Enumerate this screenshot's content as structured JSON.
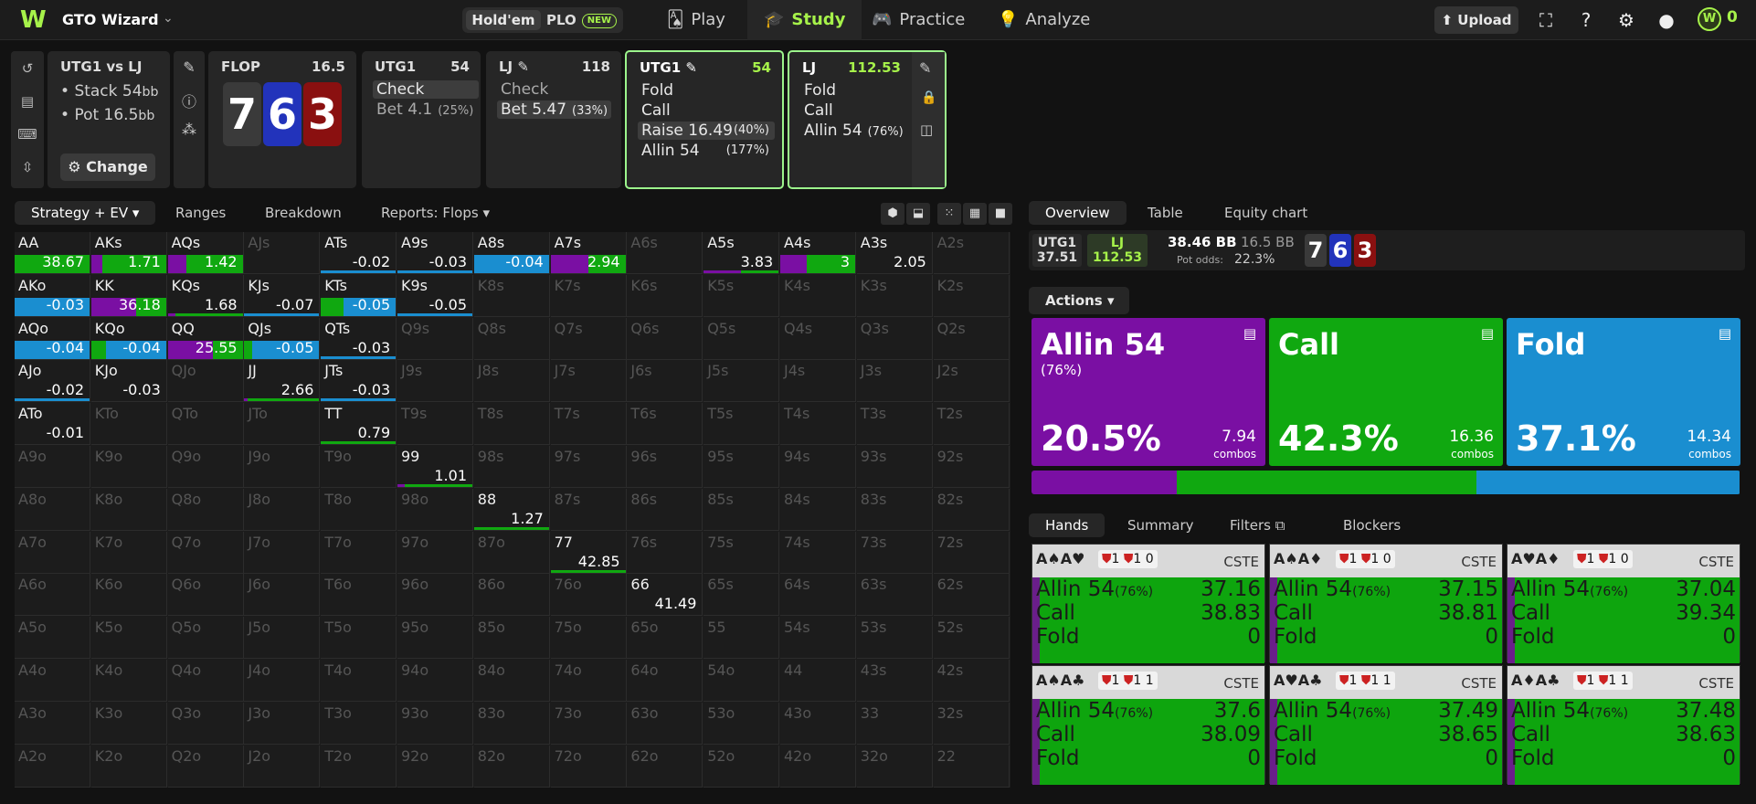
{
  "topbar": {
    "brand": "GTO Wizard",
    "game_holdem": "Hold'em",
    "game_plo": "PLO",
    "plo_badge": "NEW",
    "nav": [
      {
        "label": "Play",
        "icon": "cards-icon"
      },
      {
        "label": "Study",
        "icon": "graduation-cap-icon"
      },
      {
        "label": "Practice",
        "icon": "gamepad-icon"
      },
      {
        "label": "Analyze",
        "icon": "lightbulb-icon"
      }
    ],
    "upload": "Upload",
    "credits": "0"
  },
  "info": {
    "title": "UTG1 vs LJ",
    "stack_label": "Stack 54",
    "stack_unit": "bb",
    "pot_label": "Pot 16.5",
    "pot_unit": "bb",
    "change": "Change"
  },
  "flop": {
    "title": "FLOP",
    "pot": "16.5",
    "cards": [
      {
        "rank": "7",
        "color": "#3a3a3a"
      },
      {
        "rank": "6",
        "color": "#2233bb"
      },
      {
        "rank": "3",
        "color": "#8a1010"
      }
    ]
  },
  "nodes": [
    {
      "player": "UTG1",
      "stack": "54",
      "actions": [
        {
          "label": "Check",
          "pct": "",
          "sel": true
        },
        {
          "label": "Bet 4.1",
          "pct": "(25%)",
          "sel": false
        }
      ]
    },
    {
      "player": "LJ",
      "stack": "118",
      "actions": [
        {
          "label": "Check",
          "pct": "",
          "sel": false
        },
        {
          "label": "Bet 5.47",
          "pct": "(33%)",
          "sel": true
        }
      ]
    },
    {
      "player": "UTG1",
      "stack": "54",
      "actions": [
        {
          "label": "Fold",
          "pct": ""
        },
        {
          "label": "Call",
          "pct": ""
        },
        {
          "label": "Raise 16.49",
          "pct": "(40%)",
          "sel": true
        },
        {
          "label": "Allin 54",
          "pct": "(177%)"
        }
      ]
    },
    {
      "player": "LJ",
      "stack": "112.53",
      "actions": [
        {
          "label": "Fold",
          "pct": ""
        },
        {
          "label": "Call",
          "pct": ""
        },
        {
          "label": "Allin 54",
          "pct": "(76%)"
        }
      ]
    }
  ],
  "left_tabs": [
    "Strategy + EV",
    "Ranges",
    "Breakdown",
    "Reports: Flops"
  ],
  "colors": {
    "allin": "#7a0fa3",
    "call": "#10a810",
    "fold": "#1a8ed0",
    "accent": "#a6f24a"
  },
  "grid": {
    "ranks": [
      "A",
      "K",
      "Q",
      "J",
      "T",
      "9",
      "8",
      "7",
      "6",
      "5",
      "4",
      "3",
      "2"
    ],
    "cells": {
      "AA": {
        "ev": "38.67",
        "a": 0,
        "c": 1,
        "f": 0
      },
      "AKs": {
        "ev": "1.71",
        "a": 0.15,
        "c": 0.85,
        "f": 0
      },
      "AQs": {
        "ev": "1.42",
        "a": 0.25,
        "c": 0.75,
        "f": 0
      },
      "ATs": {
        "ev": "-0.02",
        "a": 0,
        "c": 0,
        "f": 1,
        "thin": true
      },
      "A9s": {
        "ev": "-0.03",
        "a": 0,
        "c": 0,
        "f": 1,
        "thin": true
      },
      "A8s": {
        "ev": "-0.04",
        "a": 0,
        "c": 0,
        "f": 1
      },
      "A7s": {
        "ev": "2.94",
        "a": 0.5,
        "c": 0.5,
        "f": 0
      },
      "A5s": {
        "ev": "3.83",
        "a": 0.5,
        "c": 0.5,
        "f": 0,
        "thin": true
      },
      "A4s": {
        "ev": "3",
        "a": 0.35,
        "c": 0.65,
        "f": 0
      },
      "A3s": {
        "ev": "2.05",
        "a": 0,
        "c": 0,
        "f": 0,
        "thin": true
      },
      "AKo": {
        "ev": "-0.03",
        "a": 0,
        "c": 0,
        "f": 1
      },
      "KK": {
        "ev": "36.18",
        "a": 0.6,
        "c": 0.4,
        "f": 0
      },
      "KQs": {
        "ev": "1.68",
        "a": 0.1,
        "c": 0.9,
        "f": 0,
        "thin": true
      },
      "KJs": {
        "ev": "-0.07",
        "a": 0,
        "c": 0,
        "f": 1,
        "thin": true
      },
      "KTs": {
        "ev": "-0.05",
        "a": 0,
        "c": 0.3,
        "f": 0.7
      },
      "K9s": {
        "ev": "-0.05",
        "a": 0,
        "c": 0,
        "f": 1,
        "thin": true
      },
      "AQo": {
        "ev": "-0.04",
        "a": 0,
        "c": 0,
        "f": 1
      },
      "KQo": {
        "ev": "-0.04",
        "a": 0,
        "c": 0.2,
        "f": 0.8
      },
      "QQ": {
        "ev": "25.55",
        "a": 0.6,
        "c": 0.4,
        "f": 0
      },
      "QJs": {
        "ev": "-0.05",
        "a": 0,
        "c": 0.1,
        "f": 0.9
      },
      "QTs": {
        "ev": "-0.03",
        "a": 0,
        "c": 0,
        "f": 1,
        "thin": true
      },
      "AJo": {
        "ev": "-0.02",
        "a": 0,
        "c": 0,
        "f": 1,
        "thin": true
      },
      "KJo": {
        "ev": "-0.03",
        "a": 0,
        "c": 0,
        "f": 0
      },
      "JJ": {
        "ev": "2.66",
        "a": 0.05,
        "c": 0.95,
        "f": 0,
        "thin": true
      },
      "JTs": {
        "ev": "-0.03",
        "a": 0,
        "c": 0,
        "f": 1,
        "thin": true
      },
      "ATo": {
        "ev": "-0.01",
        "a": 0,
        "c": 0,
        "f": 0
      },
      "TT": {
        "ev": "0.79",
        "a": 0,
        "c": 1,
        "f": 0,
        "thin": true
      },
      "99": {
        "ev": "1.01",
        "a": 0.1,
        "c": 0.9,
        "f": 0,
        "thin": true
      },
      "88": {
        "ev": "1.27",
        "a": 0,
        "c": 1,
        "f": 0,
        "thin": true
      },
      "77": {
        "ev": "42.85",
        "a": 0,
        "c": 1,
        "f": 0,
        "thin": true
      },
      "66": {
        "ev": "41.49",
        "a": 0,
        "c": 0,
        "f": 0
      }
    }
  },
  "right_tabs": [
    "Overview",
    "Table",
    "Equity chart"
  ],
  "nodebar": {
    "p1": "UTG1",
    "p1_stack": "37.51",
    "p2": "LJ",
    "p2_stack": "112.53",
    "pot": "38.46 BB",
    "pot2": "16.5 BB",
    "pot_odds_label": "Pot odds:",
    "pot_odds": "22.3%"
  },
  "actions_button": "Actions",
  "action_boxes": [
    {
      "name": "Allin 54",
      "sub": "(76%)",
      "freq": "20.5%",
      "combos": "7.94",
      "combos_label": "combos",
      "freq_val": 0.205
    },
    {
      "name": "Call",
      "sub": "",
      "freq": "42.3%",
      "combos": "16.36",
      "combos_label": "combos",
      "freq_val": 0.423
    },
    {
      "name": "Fold",
      "sub": "",
      "freq": "37.1%",
      "combos": "14.34",
      "combos_label": "combos",
      "freq_val": 0.371
    }
  ],
  "hands_tabs": [
    "Hands",
    "Summary",
    "Filters",
    "Blockers"
  ],
  "hand_cards": [
    {
      "hand": "A♠A♥",
      "b1": "1",
      "b2": "1",
      "b3": "0",
      "tag": "CSTE",
      "allin": "37.16",
      "call": "38.83",
      "fold": "0",
      "pct": "(76%)"
    },
    {
      "hand": "A♠A♦",
      "b1": "1",
      "b2": "1",
      "b3": "0",
      "tag": "CSTE",
      "allin": "37.15",
      "call": "38.81",
      "fold": "0",
      "pct": "(76%)"
    },
    {
      "hand": "A♥A♦",
      "b1": "1",
      "b2": "1",
      "b3": "0",
      "tag": "CSTE",
      "allin": "37.04",
      "call": "39.34",
      "fold": "0",
      "pct": "(76%)"
    },
    {
      "hand": "A♠A♣",
      "b1": "1",
      "b2": "1",
      "b3": "1",
      "tag": "CSTE",
      "allin": "37.6",
      "call": "38.09",
      "fold": "0",
      "pct": "(76%)"
    },
    {
      "hand": "A♥A♣",
      "b1": "1",
      "b2": "1",
      "b3": "1",
      "tag": "CSTE",
      "allin": "37.49",
      "call": "38.65",
      "fold": "0",
      "pct": "(76%)"
    },
    {
      "hand": "A♦A♣",
      "b1": "1",
      "b2": "1",
      "b3": "1",
      "tag": "CSTE",
      "allin": "37.48",
      "call": "38.63",
      "fold": "0",
      "pct": "(76%)"
    }
  ],
  "hand_row_labels": {
    "allin": "Allin 54",
    "call": "Call",
    "fold": "Fold"
  }
}
